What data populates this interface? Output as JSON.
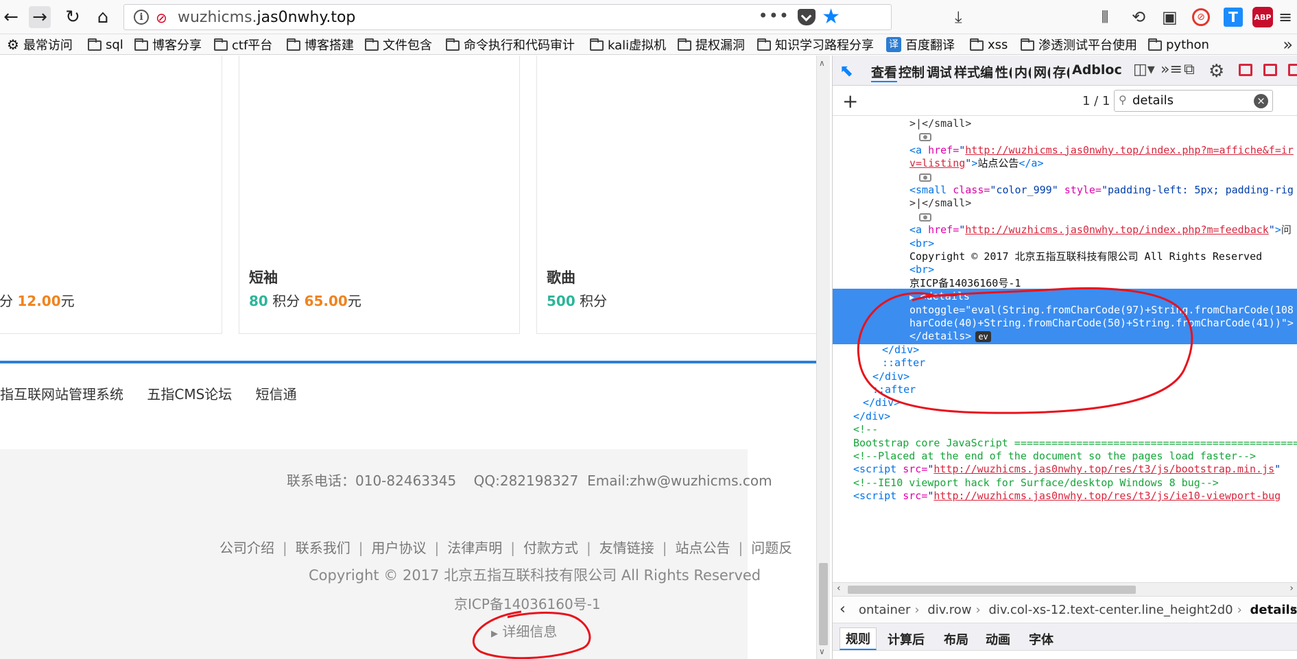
{
  "browser": {
    "url_host": "wuzhicms.",
    "url_domain": "jas0nwhy.top",
    "url_dots": "•••",
    "bookmarks": [
      {
        "label": "最常访问",
        "kind": "gear"
      },
      {
        "label": "sql",
        "kind": "folder"
      },
      {
        "label": "博客分享",
        "kind": "folder"
      },
      {
        "label": "ctf平台",
        "kind": "folder"
      },
      {
        "label": "博客搭建",
        "kind": "folder"
      },
      {
        "label": "文件包含",
        "kind": "folder"
      },
      {
        "label": "命令执行和代码审计",
        "kind": "folder"
      },
      {
        "label": "kali虚拟机",
        "kind": "folder"
      },
      {
        "label": "提权漏洞",
        "kind": "folder"
      },
      {
        "label": "知识学习路程分享",
        "kind": "folder"
      },
      {
        "label": "百度翻译",
        "kind": "translate"
      },
      {
        "label": "xss",
        "kind": "folder"
      },
      {
        "label": "渗透测试平台使用",
        "kind": "folder"
      },
      {
        "label": "python",
        "kind": "folder"
      }
    ],
    "translate_badge": "译",
    "t_badge": "T",
    "abp_badge": "ABP"
  },
  "page": {
    "cards": [
      {
        "name": "",
        "points": "分",
        "price": "12.00",
        "unit": "元"
      },
      {
        "name": "短袖",
        "points": "80",
        "points_unit": "积分",
        "price": "65.00",
        "unit": "元"
      },
      {
        "name": "歌曲",
        "points": "500",
        "points_unit": "积分"
      }
    ],
    "links": [
      "指互联网站管理系统",
      "五指CMS论坛",
      "短信通"
    ],
    "contact": "联系电话：010-82463345    QQ:282198327  Email:zhw@wuzhicms.com",
    "footer_links": [
      "公司介绍",
      "联系我们",
      "用户协议",
      "法律声明",
      "付款方式",
      "友情链接",
      "站点公告",
      "问题反"
    ],
    "copyright": "Copyright © 2017 北京五指互联科技有限公司 All Rights Reserved",
    "icp": "京ICP备14036160号-1",
    "details_summary": "详细信息"
  },
  "devtools": {
    "tabs": [
      "查看",
      "控制",
      "调试",
      "样式编",
      "性(",
      "内(",
      "网(",
      "存(",
      "Adbloc"
    ],
    "search_count": "1 / 1",
    "search_query": "details",
    "lines": [
      {
        "indent": 5,
        "html": "&gt;|&lt;/small&gt;"
      },
      {
        "indent": 6,
        "dot": true
      },
      {
        "indent": 5,
        "html": "<span class='tag n'>&lt;a</span> <span class='attr'>href=</span><span class='val'>\"</span><span class='url'>http://wuzhicms.jas0nwhy.top/index.php?m=affiche&amp;f=ir</span>"
      },
      {
        "indent": 5,
        "html": "<span class='url'>v=listing</span><span class='val'>\"</span><span class='tag n'>&gt;</span><span class='txt'>站点公告</span><span class='tag n'>&lt;/a&gt;</span>"
      },
      {
        "indent": 6,
        "dot": true
      },
      {
        "indent": 5,
        "html": "<span class='tag n'>&lt;small</span> <span class='attr'>class=</span><span class='val'>\"color_999\"</span> <span class='attr'>style=</span><span class='val'>\"padding-left: 5px; padding-rig</span>"
      },
      {
        "indent": 5,
        "html": "&gt;|&lt;/small&gt;"
      },
      {
        "indent": 6,
        "dot": true
      },
      {
        "indent": 5,
        "html": "<span class='tag n'>&lt;a</span> <span class='attr'>href=</span><span class='val'>\"</span><span class='url'>http://wuzhicms.jas0nwhy.top/index.php?m=feedback</span><span class='val'>\"</span><span class='tag n'>&gt;</span>问"
      },
      {
        "indent": 5,
        "html": "<span class='tag n'>&lt;br&gt;</span>"
      },
      {
        "indent": 5,
        "html": "<span class='txt'>Copyright © 2017 北京五指互联科技有限公司 All Rights Reserved</span>"
      },
      {
        "indent": 5,
        "html": "<span class='tag n'>&lt;br&gt;</span>"
      },
      {
        "indent": 5,
        "html": "<span class='txt'>京ICP备14036160号-1</span>"
      },
      {
        "indent": 5,
        "hl": true,
        "html": "<span class='tri'>▶</span> <span class='tag'>&lt;details</span>"
      },
      {
        "indent": 5,
        "hl": true,
        "html": "<span class='attr'>ontoggle=</span><span class='val'>\"eval(String.fromCharCode(97)+String.fromCharCode(108</span>"
      },
      {
        "indent": 5,
        "hl": true,
        "html": "<span class='val'>harCode(40)+String.fromCharCode(50)+String.fromCharCode(41))\"&gt;</span>"
      },
      {
        "indent": 5,
        "hl": true,
        "html": "<span class='tag'>&lt;/details&gt;</span><span class='ev'>ev</span>"
      },
      {
        "indent": 4,
        "html": "<span class='tag n'>&lt;/div&gt;</span>"
      },
      {
        "indent": 4,
        "html": "<span class='pseudo'>::after</span>"
      },
      {
        "indent": 3,
        "html": "<span class='tag n'>&lt;/div&gt;</span>"
      },
      {
        "indent": 3,
        "html": "<span class='pseudo'>::after</span>"
      },
      {
        "indent": 2,
        "html": "<span class='tag n'>&lt;/div&gt;</span>"
      },
      {
        "indent": 1,
        "html": "<span class='tag n'>&lt;/div&gt;</span>"
      },
      {
        "indent": 1,
        "html": "<span class='cmt'>&lt;!--</span>"
      },
      {
        "indent": 1,
        "html": "<span class='cmt'>Bootstrap core JavaScript ================================================</span>"
      },
      {
        "indent": 1,
        "html": "<span class='cmt'>&lt;!--Placed at the end of the document so the pages load faster--&gt;</span>"
      },
      {
        "indent": 1,
        "html": "<span class='tag n'>&lt;script</span> <span class='attr'>src=</span><span class='val'>\"</span><span class='url'>http://wuzhicms.jas0nwhy.top/res/t3/js/bootstrap.min.js</span><span class='val'>\"</span>"
      },
      {
        "indent": 1,
        "html": "<span class='cmt'>&lt;!--IE10 viewport hack for Surface/desktop Windows 8 bug--&gt;</span>"
      },
      {
        "indent": 1,
        "html": "<span class='tag n'>&lt;script</span> <span class='attr'>src=</span><span class='val'>\"</span><span class='url'>http://wuzhicms.jas0nwhy.top/res/t3/js/ie10-viewport-bug</span>"
      }
    ],
    "breadcrumbs": [
      "ontainer",
      "div.row",
      "div.col-xs-12.text-center.line_height2d0",
      "details"
    ],
    "subtabs": [
      "规则",
      "计算后",
      "布局",
      "动画",
      "字体"
    ]
  }
}
